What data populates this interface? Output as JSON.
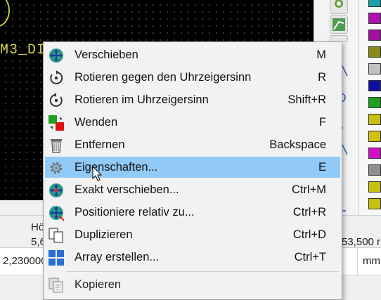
{
  "canvas": {
    "ref_text": "M3_DI"
  },
  "status": {
    "label_left": "Hö",
    "value_left": "5,6",
    "coord_left": "2,230000",
    "coord_right": "53,500 r",
    "unit": "mm"
  },
  "layer_colors": [
    "#1aa0a8",
    "#b010b0",
    "#a010a0",
    "#8a8a1a",
    "#c0c0c0",
    "#1010a0",
    "#20a020",
    "#c8c010",
    "#d0c010",
    "#d010c8",
    "#909090",
    "#c8c010",
    "#c8c010"
  ],
  "context_menu": {
    "items": [
      {
        "label": "Verschieben",
        "shortcut": "M",
        "icon": "move-icon"
      },
      {
        "label": "Rotieren gegen den Uhrzeigersinn",
        "shortcut": "R",
        "icon": "rotate-ccw-icon"
      },
      {
        "label": "Rotieren im Uhrzeigersinn",
        "shortcut": "Shift+R",
        "icon": "rotate-cw-icon"
      },
      {
        "label": "Wenden",
        "shortcut": "F",
        "icon": "flip-icon"
      },
      {
        "label": "Entfernen",
        "shortcut": "Backspace",
        "icon": "trash-icon"
      },
      {
        "label": "Eigenschaften...",
        "shortcut": "E",
        "icon": "gear-icon",
        "highlighted": true
      },
      {
        "label": "Exakt verschieben...",
        "shortcut": "Ctrl+M",
        "icon": "move-exact-icon"
      },
      {
        "label": "Positioniere relativ zu...",
        "shortcut": "Ctrl+R",
        "icon": "position-relative-icon"
      },
      {
        "label": "Duplizieren",
        "shortcut": "Ctrl+D",
        "icon": "duplicate-icon"
      },
      {
        "label": "Array erstellen...",
        "shortcut": "Ctrl+T",
        "icon": "array-icon"
      },
      {
        "label": "Kopieren",
        "shortcut": "",
        "icon": "copy-icon",
        "disabled_look": true
      }
    ]
  }
}
